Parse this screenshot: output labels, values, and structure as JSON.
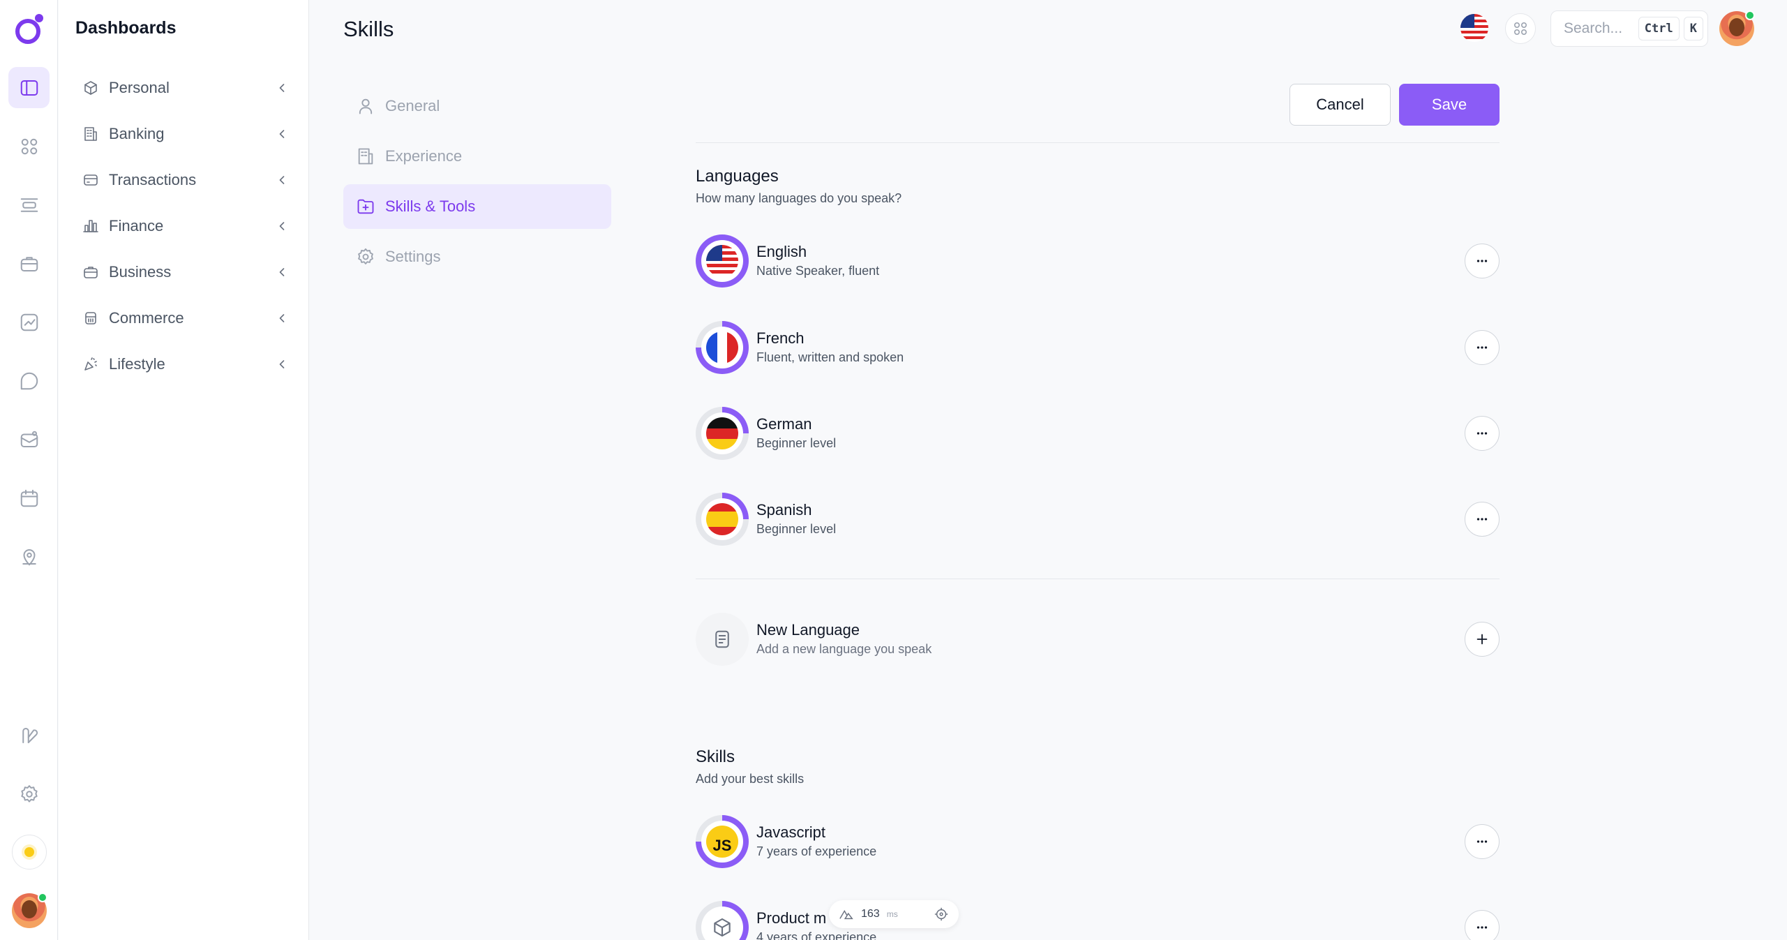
{
  "rail": {
    "items": [
      {
        "icon": "sidebar-panel-icon",
        "active": true
      },
      {
        "icon": "grid-icon",
        "active": false
      },
      {
        "icon": "layout-rows-icon",
        "active": false
      },
      {
        "icon": "briefcase-icon",
        "active": false
      },
      {
        "icon": "chart-icon",
        "active": false
      },
      {
        "icon": "chat-bubble-icon",
        "active": false
      },
      {
        "icon": "mailbox-icon",
        "active": false
      },
      {
        "icon": "calendar-icon",
        "active": false
      },
      {
        "icon": "map-pin-icon",
        "active": false
      },
      {
        "icon": "feather-icon",
        "active": false
      },
      {
        "icon": "gear-icon",
        "active": false
      }
    ]
  },
  "sidebar": {
    "title": "Dashboards",
    "items": [
      {
        "label": "Personal",
        "icon": "box-icon"
      },
      {
        "label": "Banking",
        "icon": "building-icon"
      },
      {
        "label": "Transactions",
        "icon": "credit-card-icon"
      },
      {
        "label": "Finance",
        "icon": "bar-chart-icon"
      },
      {
        "label": "Business",
        "icon": "briefcase-icon"
      },
      {
        "label": "Commerce",
        "icon": "shopping-basket-icon"
      },
      {
        "label": "Lifestyle",
        "icon": "party-icon"
      }
    ]
  },
  "header": {
    "title": "Skills",
    "search_placeholder": "Search...",
    "kbd_ctrl": "Ctrl",
    "kbd_k": "K"
  },
  "subnav": [
    {
      "label": "General",
      "icon": "user-icon",
      "active": false
    },
    {
      "label": "Experience",
      "icon": "building-icon",
      "active": false
    },
    {
      "label": "Skills & Tools",
      "icon": "folder-plus-icon",
      "active": true
    },
    {
      "label": "Settings",
      "icon": "gear-icon",
      "active": false
    }
  ],
  "actions": {
    "cancel": "Cancel",
    "save": "Save"
  },
  "languages": {
    "title": "Languages",
    "subtitle": "How many languages do you speak?",
    "items": [
      {
        "name": "English",
        "desc": "Native Speaker, fluent",
        "flag": "us",
        "level": 1.0
      },
      {
        "name": "French",
        "desc": "Fluent, written and spoken",
        "flag": "fr",
        "level": 0.75
      },
      {
        "name": "German",
        "desc": "Beginner level",
        "flag": "de",
        "level": 0.25
      },
      {
        "name": "Spanish",
        "desc": "Beginner level",
        "flag": "es",
        "level": 0.25
      }
    ],
    "new": {
      "name": "New Language",
      "desc": "Add a new language you speak"
    }
  },
  "skills": {
    "title": "Skills",
    "subtitle": "Add your best skills",
    "items": [
      {
        "name": "Javascript",
        "desc": "7 years of experience",
        "icon": "js-icon",
        "level": 0.75
      },
      {
        "name": "Product m",
        "desc": "4 years of experience",
        "icon": "box-icon",
        "level": 0.35
      }
    ]
  },
  "perf": {
    "value": "163",
    "unit": "ms"
  },
  "colors": {
    "accent": "#8b5cf6",
    "ring_track": "#e5e7eb"
  }
}
